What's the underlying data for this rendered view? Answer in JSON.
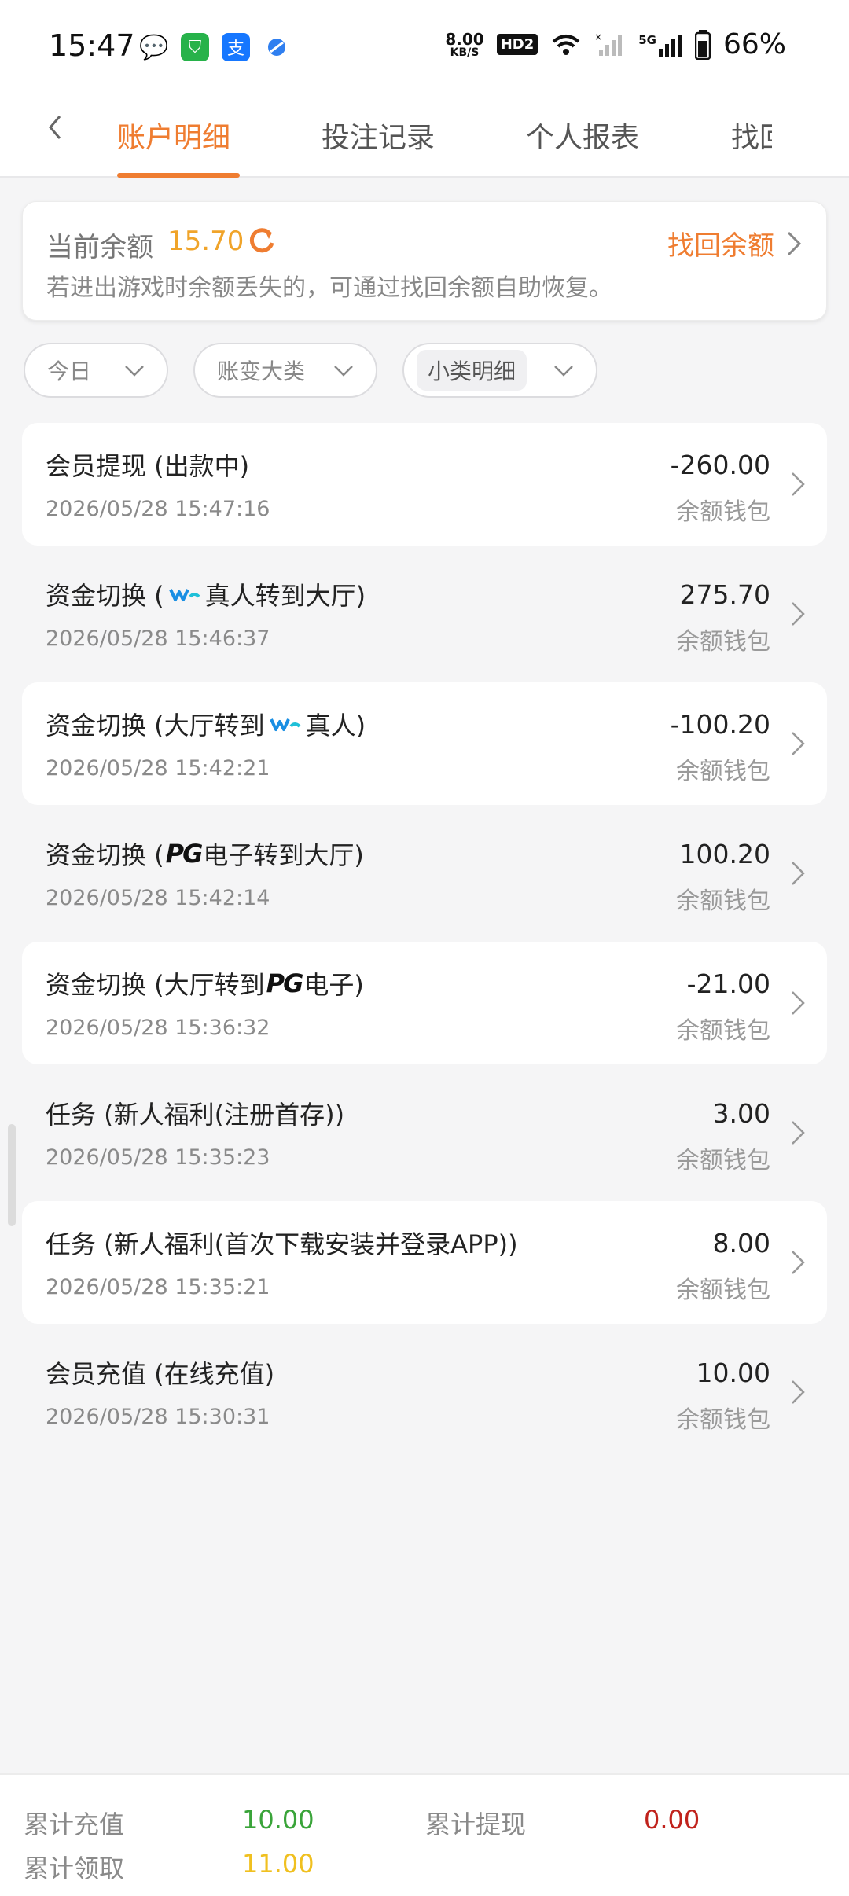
{
  "status": {
    "time": "15:47",
    "net_speed_value": "8.00",
    "net_speed_unit": "KB/S",
    "hd": "HD2",
    "battery": "66%",
    "signal_label": "5G",
    "apps": [
      "wechat-icon",
      "shield-app-icon",
      "alipay-icon",
      "browser-app-icon"
    ]
  },
  "nav": {
    "tabs": [
      "账户明细",
      "投注记录",
      "个人报表",
      "找回"
    ],
    "active_tab": 0
  },
  "balance": {
    "label": "当前余额",
    "value": "15.70",
    "hint": "若进出游戏时余额丢失的，可通过找回余额自助恢复。",
    "recover_label": "找回余额"
  },
  "filters": {
    "date": "今日",
    "category": "账变大类",
    "subcategory": "小类明细"
  },
  "transactions": [
    {
      "title_pre": "会员提现 (出款中)",
      "logo": "",
      "title_post": "",
      "date": "2026/05/28 15:47:16",
      "amount": "-260.00",
      "wallet": "余额钱包"
    },
    {
      "title_pre": "资金切换 (",
      "logo": "wm",
      "title_post": "真人转到大厅)",
      "date": "2026/05/28 15:46:37",
      "amount": "275.70",
      "wallet": "余额钱包"
    },
    {
      "title_pre": "资金切换 (大厅转到",
      "logo": "wm",
      "title_post": "真人)",
      "date": "2026/05/28 15:42:21",
      "amount": "-100.20",
      "wallet": "余额钱包"
    },
    {
      "title_pre": "资金切换 (",
      "logo": "pg",
      "title_post": "电子转到大厅)",
      "date": "2026/05/28 15:42:14",
      "amount": "100.20",
      "wallet": "余额钱包"
    },
    {
      "title_pre": "资金切换 (大厅转到",
      "logo": "pg",
      "title_post": "电子)",
      "date": "2026/05/28 15:36:32",
      "amount": "-21.00",
      "wallet": "余额钱包"
    },
    {
      "title_pre": "任务 (新人福利(注册首存))",
      "logo": "",
      "title_post": "",
      "date": "2026/05/28 15:35:23",
      "amount": "3.00",
      "wallet": "余额钱包"
    },
    {
      "title_pre": "任务 (新人福利(首次下载安装并登录APP))",
      "logo": "",
      "title_post": "",
      "date": "2026/05/28 15:35:21",
      "amount": "8.00",
      "wallet": "余额钱包"
    },
    {
      "title_pre": "会员充值 (在线充值)",
      "logo": "",
      "title_post": "",
      "date": "2026/05/28 15:30:31",
      "amount": "10.00",
      "wallet": "余额钱包"
    }
  ],
  "logos": {
    "pg": "PG"
  },
  "footer": {
    "total_deposit_label": "累计充值",
    "total_deposit_value": "10.00",
    "total_withdraw_label": "累计提现",
    "total_withdraw_value": "0.00",
    "total_claim_label": "累计领取",
    "total_claim_value": "11.00",
    "colors": {
      "deposit": "#3aa43a",
      "withdraw": "#c0221c",
      "claim": "#f0c020"
    }
  },
  "colors": {
    "accent": "#ef7d31",
    "balance": "#f0a42a"
  }
}
